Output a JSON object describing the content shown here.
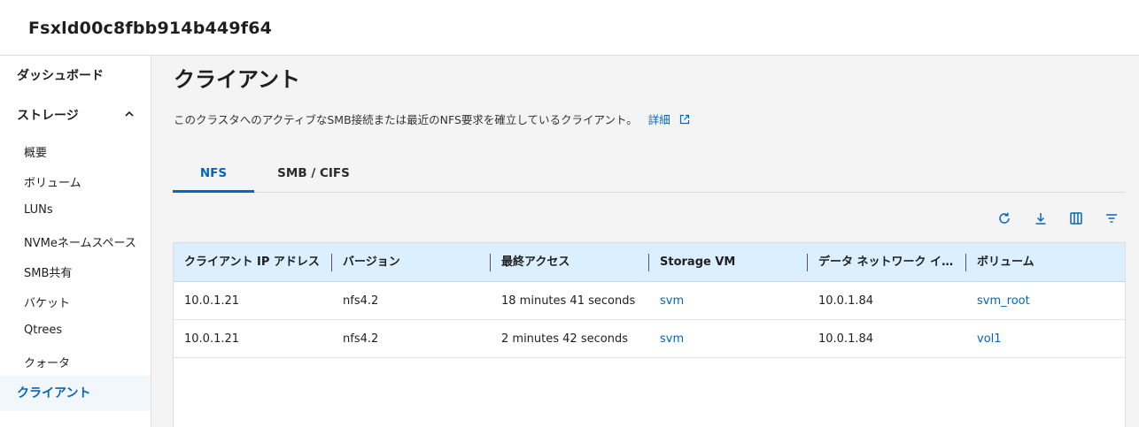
{
  "header": {
    "title": "Fsxld00c8fbb914b449f64"
  },
  "sidebar": {
    "dashboard": "ダッシュボード",
    "storage": "ストレージ",
    "items": [
      "概要",
      "ボリューム",
      "LUNs",
      "NVMeネームスペース",
      "SMB共有",
      "バケット",
      "Qtrees",
      "クォータ"
    ],
    "active": "クライアント"
  },
  "main": {
    "title": "クライアント",
    "description": "このクラスタへのアクティブなSMB接続または最近のNFS要求を確立しているクライアント。",
    "details_link": "詳細",
    "tabs": [
      {
        "label": "NFS",
        "active": true
      },
      {
        "label": "SMB / CIFS",
        "active": false
      }
    ]
  },
  "table": {
    "columns": [
      "クライアント IP アドレス",
      "バージョン",
      "最終アクセス",
      "Storage VM",
      "データ ネットワーク インターフェイス",
      "ボリューム"
    ],
    "rows": [
      [
        "10.0.1.21",
        "nfs4.2",
        "18 minutes 41 seconds",
        "svm",
        "10.0.1.84",
        "svm_root"
      ],
      [
        "10.0.1.21",
        "nfs4.2",
        "2 minutes 42 seconds",
        "svm",
        "10.0.1.84",
        "vol1"
      ]
    ]
  },
  "icons": {
    "refresh": "refresh-icon",
    "download": "download-icon",
    "columns": "columns-icon",
    "filter": "filter-icon",
    "external": "external-link-icon",
    "chevron": "chevron-up-icon"
  },
  "colors": {
    "accent": "#0467bf",
    "header_bg": "#dcefff",
    "active_bg": "#f2f7fb"
  }
}
